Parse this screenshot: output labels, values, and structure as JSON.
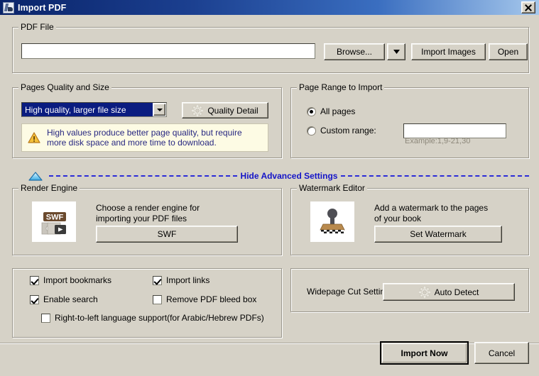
{
  "window": {
    "title": "Import PDF",
    "icon": "pdf-document-icon",
    "close_label": "X",
    "bg_color": "#d6d2c7",
    "title_color": "#0a246a"
  },
  "pdf_file": {
    "legend": "PDF File",
    "path_value": "",
    "path_placeholder": "",
    "browse_label": "Browse...",
    "dropdown_arrow": "chevron-down-icon",
    "import_images_label": "Import Images",
    "open_label": "Open"
  },
  "quality": {
    "legend": "Pages Quality and Size",
    "selected_option": "High quality, larger file size",
    "options": [
      "High quality, larger file size"
    ],
    "quality_detail_label": "Quality Detail",
    "quality_detail_icon": "gear-icon",
    "warning_icon": "warning-triangle-icon",
    "warning_text": "High values produce better page quality, but require more disk space and more time to download.",
    "warning_bg": "#fdfbe4",
    "warning_text_color": "#272781",
    "selection_color": "#0a1c80"
  },
  "page_range": {
    "legend": "Page Range to Import",
    "all_pages_label": "All pages",
    "all_pages_selected": true,
    "custom_range_label": "Custom range:",
    "custom_range_selected": false,
    "custom_range_value": "",
    "example_hint": "Example:1,9-21,30"
  },
  "advanced": {
    "toggle_label": "Hide Advanced Settings",
    "toggle_icon": "triangle-up-icon",
    "link_color": "#1414c8"
  },
  "render_engine": {
    "legend": "Render Engine",
    "icon": "swf-flash-icon",
    "icon_text": "SWF",
    "description": "Choose a render engine for\nimporting your PDF files",
    "button_label": "SWF"
  },
  "watermark": {
    "legend": "Watermark Editor",
    "icon": "rubber-stamp-icon",
    "description": "Add a watermark to the pages\nof your book",
    "button_label": "Set Watermark"
  },
  "options": {
    "import_bookmarks": {
      "label": "Import bookmarks",
      "checked": true
    },
    "import_links": {
      "label": "Import links",
      "checked": true
    },
    "enable_search": {
      "label": "Enable search",
      "checked": true
    },
    "remove_bleed_box": {
      "label": "Remove PDF bleed box",
      "checked": false
    },
    "rtl_support": {
      "label": "Right-to-left language support(for Arabic/Hebrew PDFs)",
      "checked": false
    }
  },
  "widepage": {
    "label": "Widepage Cut Setting",
    "button_label": "Auto Detect",
    "button_icon": "gear-icon"
  },
  "footer": {
    "import_now_label": "Import Now",
    "cancel_label": "Cancel"
  }
}
